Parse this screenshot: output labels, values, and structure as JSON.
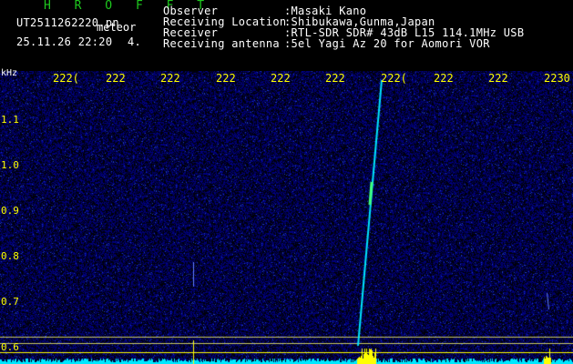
{
  "title": "H R O F F T",
  "file_name": "UT2511262220.pn",
  "event_type": "meteor",
  "datetime": "25.11.26 22:20",
  "count": "4.",
  "info": [
    {
      "label": "Observer",
      "value": ":Masaki Kano"
    },
    {
      "label": "Receiving Location",
      "value": ":Shibukawa,Gunma,Japan"
    },
    {
      "label": "Receiver",
      "value": ":RTL-SDR SDR# 43dB L15 114.1MHz USB"
    },
    {
      "label": "Receiving antenna",
      "value": ":5el Yagi Az 20 for Aomori VOR"
    }
  ],
  "freq_unit": "kHz",
  "freq_ticks": [
    "1.1",
    "1.0",
    "0.9",
    "0.8",
    "0.7",
    "0.6"
  ],
  "time_ticks": [
    "2220",
    "2221",
    "2222",
    "2223",
    "2224",
    "2225",
    "2226",
    "2227",
    "2228",
    "2229",
    "2230"
  ],
  "time_tick_labels": [
    "222(",
    "222",
    "222",
    "222",
    "222",
    "222",
    "222(",
    "222",
    "222",
    "222",
    "2230"
  ],
  "colors": {
    "background": "#000000",
    "noise": "#0a0a6e",
    "trace": "#00ffff",
    "axis": "#ffff00",
    "logo": "#1ec81e"
  }
}
